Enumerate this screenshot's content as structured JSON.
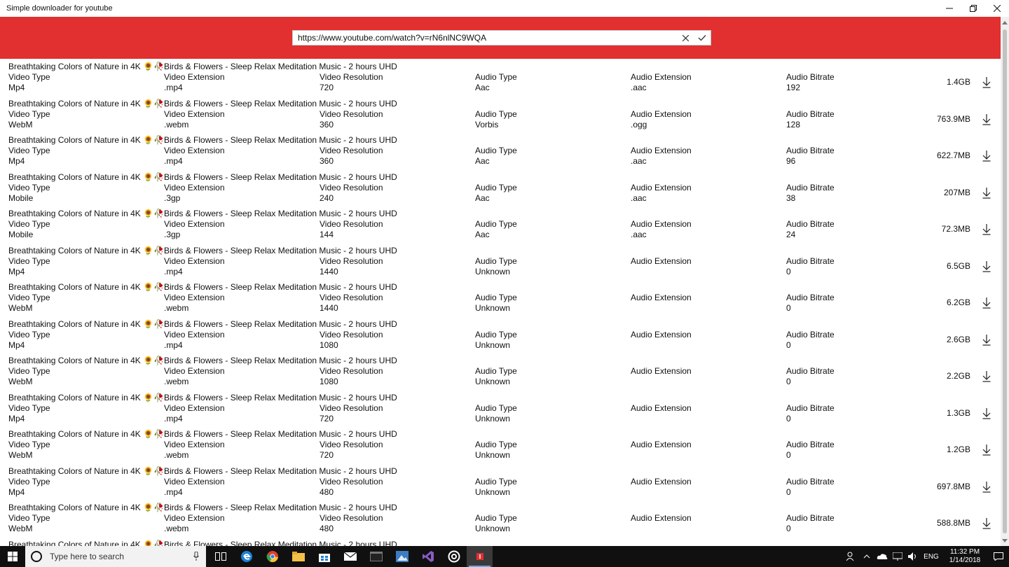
{
  "window": {
    "title": "Simple downloader for youtube"
  },
  "colors": {
    "accent": "#e1302f",
    "taskbar": "#101010"
  },
  "url_bar": {
    "value": "https://www.youtube.com/watch?v=rN6nlNC9WQA",
    "clear_icon": "close-icon",
    "submit_icon": "checkmark-icon"
  },
  "labels": {
    "video_type": "Video Type",
    "video_extension": "Video Extension",
    "video_resolution": "Video Resolution",
    "audio_type": "Audio Type",
    "audio_extension": "Audio Extension",
    "audio_bitrate": "Audio Bitrate"
  },
  "title_parts": {
    "before": "Breathtaking Colors of Nature in 4K ",
    "emoji1": "🌻",
    "emoji2": "🥀",
    "after": "Birds & Flowers - Sleep Relax Meditation Music - 2 hours UHD"
  },
  "items": [
    {
      "video_type": "Mp4",
      "video_extension": ".mp4",
      "video_resolution": "720",
      "audio_type": "Aac",
      "audio_extension": ".aac",
      "audio_bitrate": "192",
      "size": "1.4GB"
    },
    {
      "video_type": "WebM",
      "video_extension": ".webm",
      "video_resolution": "360",
      "audio_type": "Vorbis",
      "audio_extension": ".ogg",
      "audio_bitrate": "128",
      "size": "763.9MB"
    },
    {
      "video_type": "Mp4",
      "video_extension": ".mp4",
      "video_resolution": "360",
      "audio_type": "Aac",
      "audio_extension": ".aac",
      "audio_bitrate": "96",
      "size": "622.7MB"
    },
    {
      "video_type": "Mobile",
      "video_extension": ".3gp",
      "video_resolution": "240",
      "audio_type": "Aac",
      "audio_extension": ".aac",
      "audio_bitrate": "38",
      "size": "207MB"
    },
    {
      "video_type": "Mobile",
      "video_extension": ".3gp",
      "video_resolution": "144",
      "audio_type": "Aac",
      "audio_extension": ".aac",
      "audio_bitrate": "24",
      "size": "72.3MB"
    },
    {
      "video_type": "Mp4",
      "video_extension": ".mp4",
      "video_resolution": "1440",
      "audio_type": "Unknown",
      "audio_extension": "",
      "audio_bitrate": "0",
      "size": "6.5GB"
    },
    {
      "video_type": "WebM",
      "video_extension": ".webm",
      "video_resolution": "1440",
      "audio_type": "Unknown",
      "audio_extension": "",
      "audio_bitrate": "0",
      "size": "6.2GB"
    },
    {
      "video_type": "Mp4",
      "video_extension": ".mp4",
      "video_resolution": "1080",
      "audio_type": "Unknown",
      "audio_extension": "",
      "audio_bitrate": "0",
      "size": "2.6GB"
    },
    {
      "video_type": "WebM",
      "video_extension": ".webm",
      "video_resolution": "1080",
      "audio_type": "Unknown",
      "audio_extension": "",
      "audio_bitrate": "0",
      "size": "2.2GB"
    },
    {
      "video_type": "Mp4",
      "video_extension": ".mp4",
      "video_resolution": "720",
      "audio_type": "Unknown",
      "audio_extension": "",
      "audio_bitrate": "0",
      "size": "1.3GB"
    },
    {
      "video_type": "WebM",
      "video_extension": ".webm",
      "video_resolution": "720",
      "audio_type": "Unknown",
      "audio_extension": "",
      "audio_bitrate": "0",
      "size": "1.2GB"
    },
    {
      "video_type": "Mp4",
      "video_extension": ".mp4",
      "video_resolution": "480",
      "audio_type": "Unknown",
      "audio_extension": "",
      "audio_bitrate": "0",
      "size": "697.8MB"
    },
    {
      "video_type": "WebM",
      "video_extension": ".webm",
      "video_resolution": "480",
      "audio_type": "Unknown",
      "audio_extension": "",
      "audio_bitrate": "0",
      "size": "588.8MB"
    },
    {
      "video_type": "",
      "video_extension": "",
      "video_resolution": "",
      "audio_type": "",
      "audio_extension": "",
      "audio_bitrate": "",
      "size": ""
    }
  ],
  "taskbar": {
    "search_placeholder": "Type here to search",
    "apps": [
      "task-view-icon",
      "edge-icon",
      "chrome-icon",
      "file-explorer-icon",
      "store-icon",
      "mail-icon",
      "terminal-icon",
      "photos-icon",
      "visual-studio-icon",
      "media-icon",
      "downloader-app-icon"
    ],
    "language": "ENG",
    "time": "11:32 PM",
    "date": "1/14/2018"
  }
}
